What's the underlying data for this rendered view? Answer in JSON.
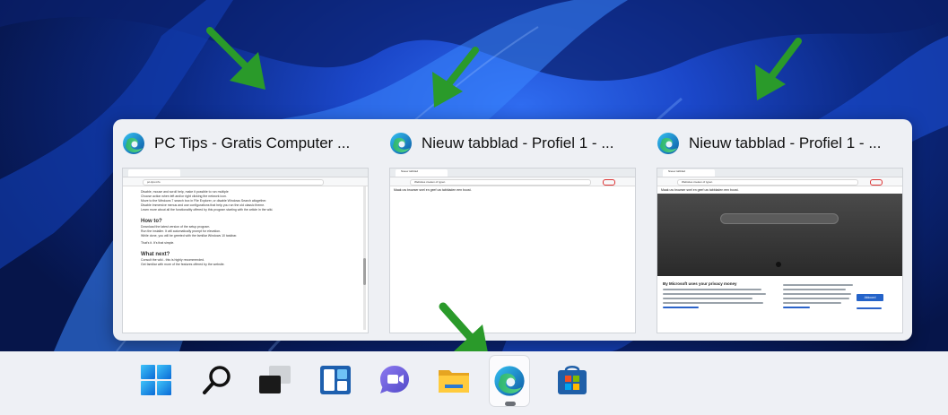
{
  "colors": {
    "accent_green": "#2a9a2a",
    "taskbar_bg": "#eef0f5",
    "panel_bg": "#eef0f4"
  },
  "previews": [
    {
      "icon": "edge-icon",
      "title": "PC Tips - Gratis Computer ...",
      "url": "pc-tips.info",
      "lines": [
        "Disable, mouse and scroll help, make it possible to run multiple",
        "Choose action when left and/or right clicking the network icon.",
        "Move to the Windows 7 search box in File Explorer, or disable Windows Search altogether.",
        "Disable Immersive menus and use configurations that help you run the old classic theme.",
        "Learn more about all the functionality offered by this program starting with the article in the wiki."
      ],
      "heading1": "How to?",
      "steps": [
        "Download the latest version of the setup program.",
        "Run the installer. It will automatically prompt for elevation.",
        "While done, you will be greeted with the familiar Windows 10 taskbar."
      ],
      "closing": "That's it. It's that simple.",
      "heading2": "What next?",
      "next_items": [
        "Consult the wiki - this is highly recommended.",
        "Get familiar with more of the features offered by the website."
      ]
    },
    {
      "icon": "edge-icon",
      "title": "Nieuw tabblad - Profiel 1 - ...",
      "tab_label": "Nieuw tabblad",
      "url": "Websites zoeken of typen",
      "banner": "Maak uw browser snel en geef uw tabbladen een boost."
    },
    {
      "icon": "edge-icon",
      "title": "Nieuw tabblad - Profiel 1 - ...",
      "tab_label": "Nieuw tabblad",
      "url": "Websites zoeken of typen",
      "banner": "Maak uw browser snel en geef uw tabbladen een boost.",
      "privacy_title": "By Microsoft uses your privacy money",
      "privacy_button": "Akkoord"
    }
  ],
  "taskbar": {
    "items": [
      {
        "name": "start-button",
        "icon": "windows-logo-icon"
      },
      {
        "name": "search-button",
        "icon": "search-icon"
      },
      {
        "name": "task-view-button",
        "icon": "task-view-icon"
      },
      {
        "name": "widgets-button",
        "icon": "widgets-icon"
      },
      {
        "name": "teams-chat-button",
        "icon": "teams-chat-icon"
      },
      {
        "name": "file-explorer-button",
        "icon": "folder-icon"
      },
      {
        "name": "edge-button",
        "icon": "edge-icon",
        "active": true
      },
      {
        "name": "store-button",
        "icon": "store-icon"
      }
    ]
  }
}
